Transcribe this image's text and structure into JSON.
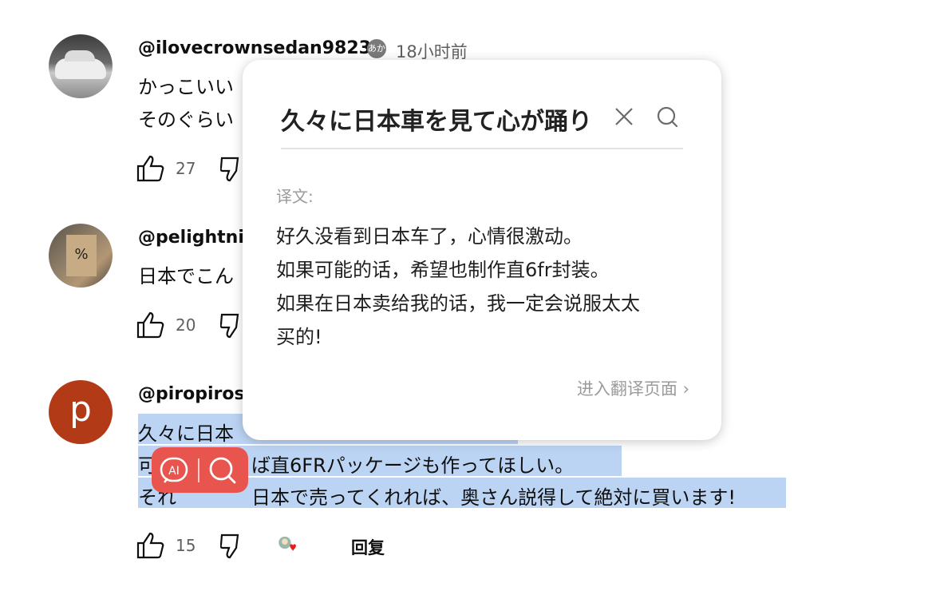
{
  "comments": [
    {
      "author": "@ilovecrownsedan9823",
      "time": "18小时前",
      "badge": "あか",
      "lines": [
        "かっこいい",
        "そのぐらい"
      ],
      "likes": "27"
    },
    {
      "author": "@pelightni",
      "avatar_text": "%",
      "lines": [
        "日本でこん"
      ],
      "likes": "20"
    },
    {
      "author": "@piropirose",
      "avatar_letter": "p",
      "lines": [
        "久々に日本",
        "可",
        "ば直6FRパッケージも作ってほしい。",
        "それ",
        "日本で売ってくれれば、奥さん説得して絶対に買います!"
      ],
      "likes": "15",
      "reply_label": "回复"
    }
  ],
  "popup": {
    "query": "久々に日本車を見て心が踊り",
    "label": "译文:",
    "translation": [
      "好久没看到日本车了，心情很激动。",
      "如果可能的话，希望也制作直6fr封装。",
      "如果在日本卖给我的话，我一定会说服太太",
      "买的!"
    ],
    "link": "进入翻译页面 ›"
  },
  "toolbar": {
    "ai_label": "AI"
  },
  "colors": {
    "selection": "#bcd4f4",
    "ai_button": "#e8554e",
    "accent_text": "#0f0f0f"
  }
}
